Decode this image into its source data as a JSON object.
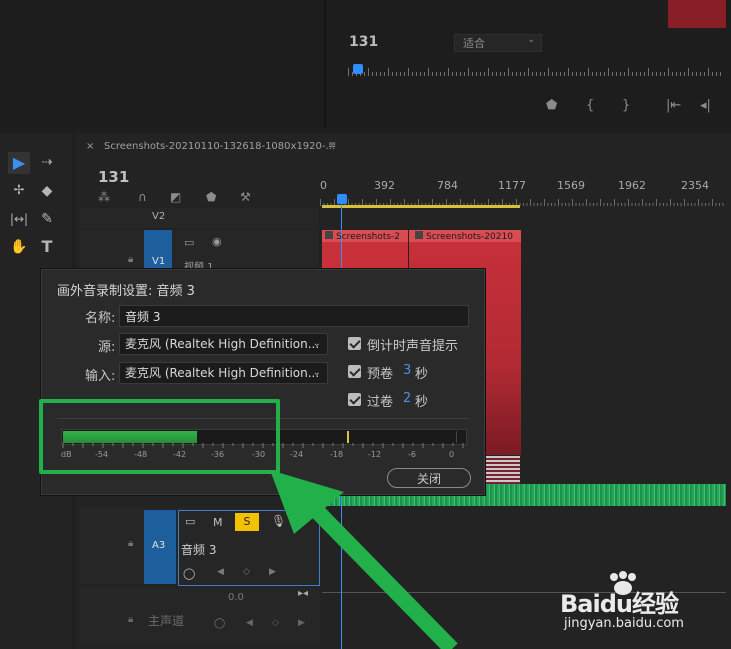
{
  "program_monitor": {
    "timecode": "131",
    "fit_label": "适合"
  },
  "sequence": {
    "tab_title": "Screenshots-20210110-132618-1080x1920-...",
    "timecode": "131",
    "ruler_ticks": [
      "0",
      "392",
      "784",
      "1177",
      "1569",
      "1962",
      "2354"
    ]
  },
  "tracks": {
    "v2": "V2",
    "v1": "V1",
    "v1_name": "视频 1",
    "a3": "A3",
    "a3_name": "音频 3",
    "a3_mute": "M",
    "a3_solo": "S",
    "master_label": "主声道",
    "master_value": "0.0"
  },
  "clips": {
    "clip1": "Screenshots-2",
    "clip2": "Screenshots-20210"
  },
  "dialog": {
    "title": "画外音录制设置: 音频 3",
    "name_label": "名称:",
    "name_value": "音频 3",
    "source_label": "源:",
    "source_value": "麦克风 (Realtek High Definition...",
    "input_label": "输入:",
    "input_value": "麦克风 (Realtek High Definition...",
    "countdown_label": "倒计时声音提示",
    "preroll_label": "预卷",
    "preroll_value": "3",
    "preroll_unit": "秒",
    "postroll_label": "过卷",
    "postroll_value": "2",
    "postroll_unit": "秒",
    "meter_ticks": [
      "dB",
      "-54",
      "-48",
      "-42",
      "-36",
      "-30",
      "-24",
      "-18",
      "-12",
      "-6",
      "0"
    ],
    "meter_level_db": -40,
    "close_label": "关闭"
  },
  "watermark": {
    "brand": "Baidu经验",
    "url": "jingyan.baidu.com"
  },
  "colors": {
    "clip_red": "#c8303a",
    "highlight_green": "#22b04a",
    "track_blue": "#1c5f9c",
    "solo_yellow": "#f2c200"
  }
}
